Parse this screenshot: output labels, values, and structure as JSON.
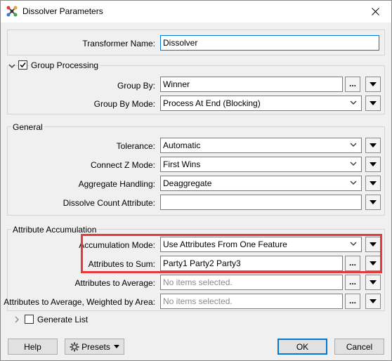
{
  "window": {
    "title": "Dissolver Parameters"
  },
  "transformer_name": {
    "label": "Transformer Name:",
    "value": "Dissolver"
  },
  "group_processing": {
    "title": "Group Processing",
    "checked": true,
    "group_by": {
      "label": "Group By:",
      "value": "Winner"
    },
    "group_by_mode": {
      "label": "Group By Mode:",
      "value": "Process At End (Blocking)"
    }
  },
  "general": {
    "title": "General",
    "tolerance": {
      "label": "Tolerance:",
      "value": "Automatic"
    },
    "connect_z_mode": {
      "label": "Connect Z Mode:",
      "value": "First Wins"
    },
    "aggregate_handling": {
      "label": "Aggregate Handling:",
      "value": "Deaggregate"
    },
    "dissolve_count_attribute": {
      "label": "Dissolve Count Attribute:",
      "value": ""
    }
  },
  "attribute_accumulation": {
    "title": "Attribute Accumulation",
    "accumulation_mode": {
      "label": "Accumulation Mode:",
      "value": "Use Attributes From One Feature"
    },
    "attributes_to_sum": {
      "label": "Attributes to Sum:",
      "value": "Party1 Party2 Party3"
    },
    "attributes_to_average": {
      "label": "Attributes to Average:",
      "placeholder": "No items selected."
    },
    "attributes_to_average_weighted": {
      "label": "Attributes to Average, Weighted by Area:",
      "placeholder": "No items selected."
    }
  },
  "generate_list": {
    "label": "Generate List",
    "checked": false
  },
  "footer": {
    "help": "Help",
    "presets": "Presets",
    "ok": "OK",
    "cancel": "Cancel"
  },
  "colors": {
    "highlight": "#e8383b",
    "focus": "#0078d7"
  }
}
